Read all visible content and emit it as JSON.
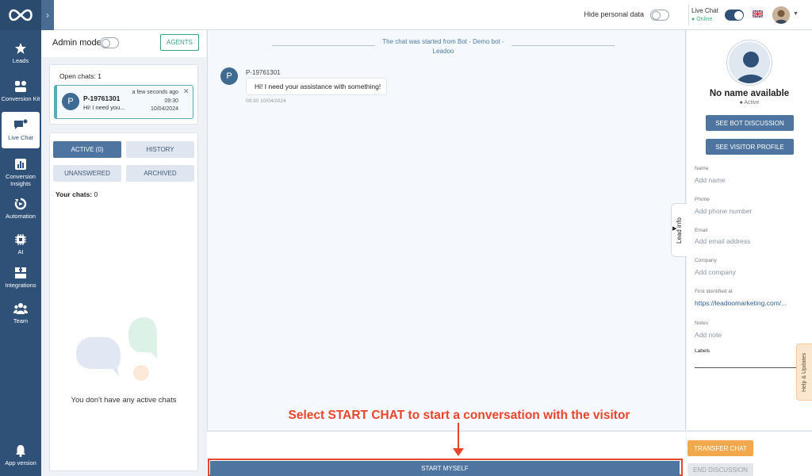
{
  "nav": {
    "items": [
      {
        "label": "Leads",
        "icon": "star-icon"
      },
      {
        "label": "Conversion Kit",
        "icon": "shapes-icon"
      },
      {
        "label": "Live Chat",
        "icon": "chat-icon"
      },
      {
        "label": "Conversion Insights",
        "icon": "bar-chart-icon"
      },
      {
        "label": "Automation",
        "icon": "automation-icon"
      },
      {
        "label": "AI",
        "icon": "ai-chip-icon"
      },
      {
        "label": "Integrations",
        "icon": "integrations-icon"
      },
      {
        "label": "Team",
        "icon": "team-icon"
      },
      {
        "label": "App version",
        "icon": "bell-icon"
      }
    ],
    "active": "Live Chat"
  },
  "topbar": {
    "hide_personal_data": "Hide personal data",
    "live_chat": "Live Chat",
    "status": "Online"
  },
  "left_panel": {
    "admin_mode": "Admin mode",
    "agents_button": "AGENTS",
    "open_chats": "Open chats: 1",
    "chat": {
      "avatar": "P",
      "name": "P-19761301",
      "preview": "Hi! I need you...",
      "relative_time": "a few seconds ago",
      "time": "09:30",
      "date": "10/04/2024"
    },
    "filters": [
      "ACTIVE (0)",
      "HISTORY",
      "UNANSWERED",
      "ARCHIVED"
    ],
    "your_chats_label": "Your chats:",
    "your_chats_count": "0",
    "empty_text": "You don't have any active chats"
  },
  "conversation": {
    "system_text": "The chat was started from Bot - Demo bot - Leadoo",
    "message": {
      "avatar": "P",
      "sender": "P-19761301",
      "text": "Hi! I need your assistance with something!",
      "timestamp": "09:30 10/04/2024"
    },
    "instruction": "Select START CHAT to start a conversation with the visitor",
    "start_button": "START MYSELF"
  },
  "right_panel": {
    "name": "No name available",
    "status": "Active",
    "see_bot_discussion": "SEE BOT DISCUSSION",
    "see_visitor_profile": "SEE VISITOR PROFILE",
    "fields": [
      {
        "label": "Name",
        "value": "Add name"
      },
      {
        "label": "Phone",
        "value": "Add phone number"
      },
      {
        "label": "Email",
        "value": "Add email address"
      },
      {
        "label": "Company",
        "value": "Add company"
      },
      {
        "label": "First identified at",
        "value": "https://leadoomarketing.com/..."
      },
      {
        "label": "Notes",
        "value": "Add note"
      }
    ],
    "labels_label": "Labels",
    "lead_info_tab": "Lead info",
    "help_tab": "Help & Updates",
    "transfer_button": "TRANSFER CHAT",
    "end_button": "END DISCUSSION"
  },
  "colors": {
    "nav_bg": "#2f5177",
    "primary": "#4e74a0",
    "accent_teal": "#3d9f8a",
    "annotation_red": "#e8452b",
    "transfer_orange": "#f2a94e",
    "online_green": "#3bb27a"
  }
}
